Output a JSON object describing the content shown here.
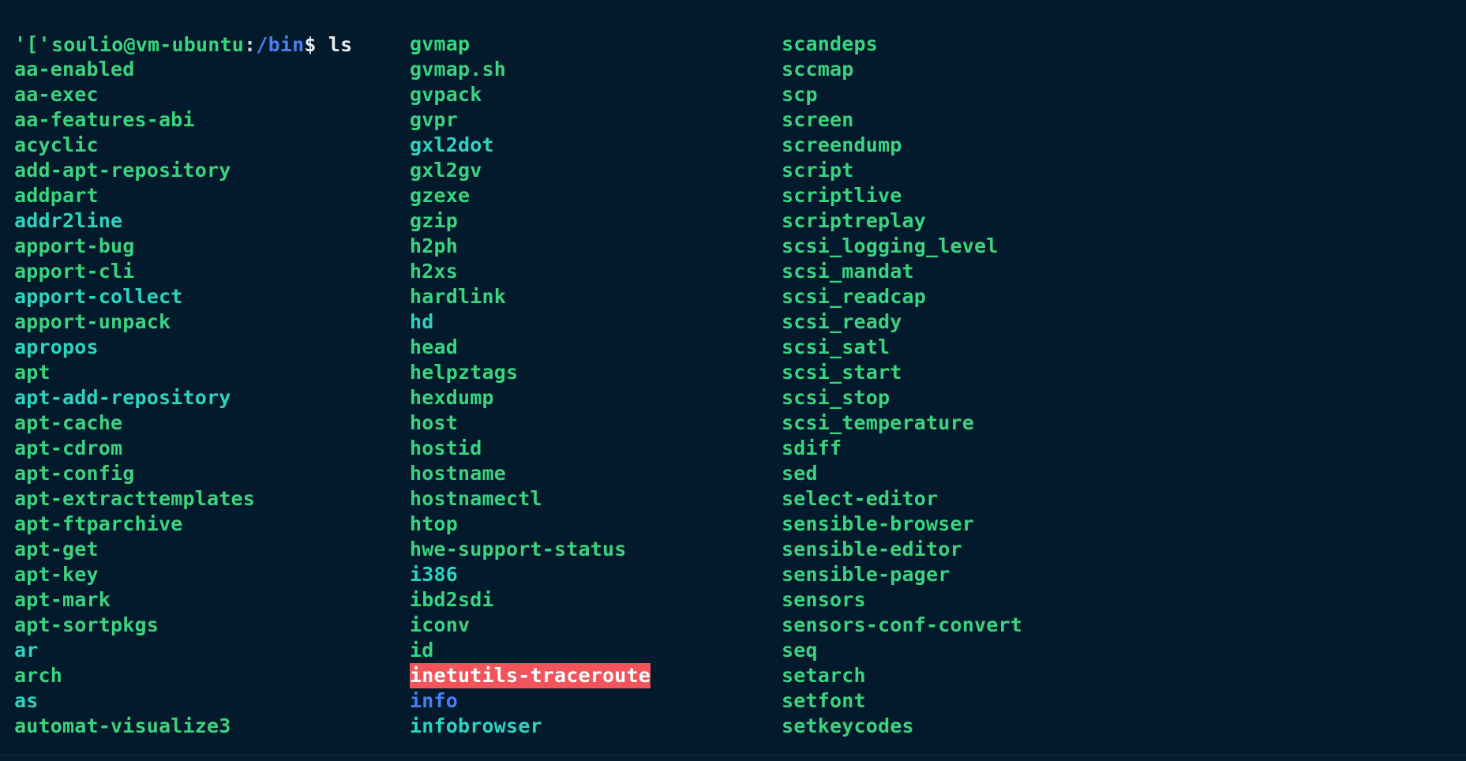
{
  "terminal": {
    "background_color": "#021a2b",
    "colors": {
      "executable_green": "#3bd37f",
      "symlink_cyan": "#2dd4bf",
      "directory_blue": "#4a7ef0",
      "orphan_link_bg": "#f2545b",
      "orphan_link_fg": "#ffffff",
      "prompt_text": "#e8eef3"
    }
  },
  "prompt": {
    "user_host": "soulio@vm-ubuntu",
    "colon": ":",
    "path": "/bin",
    "dollar": "$ ",
    "command": "ls"
  },
  "listing": {
    "columns": 3,
    "rows": 28,
    "entries": [
      [
        {
          "name": "'['",
          "type": "exe"
        },
        {
          "name": "gvmap",
          "type": "exe"
        },
        {
          "name": "scandeps",
          "type": "exe"
        }
      ],
      [
        {
          "name": "aa-enabled",
          "type": "exe"
        },
        {
          "name": "gvmap.sh",
          "type": "exe"
        },
        {
          "name": "sccmap",
          "type": "exe"
        }
      ],
      [
        {
          "name": "aa-exec",
          "type": "exe"
        },
        {
          "name": "gvpack",
          "type": "exe"
        },
        {
          "name": "scp",
          "type": "exe"
        }
      ],
      [
        {
          "name": "aa-features-abi",
          "type": "exe"
        },
        {
          "name": "gvpr",
          "type": "exe"
        },
        {
          "name": "screen",
          "type": "exe"
        }
      ],
      [
        {
          "name": "acyclic",
          "type": "exe"
        },
        {
          "name": "gxl2dot",
          "type": "link"
        },
        {
          "name": "screendump",
          "type": "exe"
        }
      ],
      [
        {
          "name": "add-apt-repository",
          "type": "exe"
        },
        {
          "name": "gxl2gv",
          "type": "exe"
        },
        {
          "name": "script",
          "type": "exe"
        }
      ],
      [
        {
          "name": "addpart",
          "type": "exe"
        },
        {
          "name": "gzexe",
          "type": "exe"
        },
        {
          "name": "scriptlive",
          "type": "exe"
        }
      ],
      [
        {
          "name": "addr2line",
          "type": "link"
        },
        {
          "name": "gzip",
          "type": "exe"
        },
        {
          "name": "scriptreplay",
          "type": "exe"
        }
      ],
      [
        {
          "name": "apport-bug",
          "type": "exe"
        },
        {
          "name": "h2ph",
          "type": "exe"
        },
        {
          "name": "scsi_logging_level",
          "type": "exe"
        }
      ],
      [
        {
          "name": "apport-cli",
          "type": "exe"
        },
        {
          "name": "h2xs",
          "type": "exe"
        },
        {
          "name": "scsi_mandat",
          "type": "exe"
        }
      ],
      [
        {
          "name": "apport-collect",
          "type": "link"
        },
        {
          "name": "hardlink",
          "type": "exe"
        },
        {
          "name": "scsi_readcap",
          "type": "exe"
        }
      ],
      [
        {
          "name": "apport-unpack",
          "type": "exe"
        },
        {
          "name": "hd",
          "type": "link"
        },
        {
          "name": "scsi_ready",
          "type": "exe"
        }
      ],
      [
        {
          "name": "apropos",
          "type": "link"
        },
        {
          "name": "head",
          "type": "exe"
        },
        {
          "name": "scsi_satl",
          "type": "exe"
        }
      ],
      [
        {
          "name": "apt",
          "type": "exe"
        },
        {
          "name": "helpztags",
          "type": "exe"
        },
        {
          "name": "scsi_start",
          "type": "exe"
        }
      ],
      [
        {
          "name": "apt-add-repository",
          "type": "link"
        },
        {
          "name": "hexdump",
          "type": "exe"
        },
        {
          "name": "scsi_stop",
          "type": "exe"
        }
      ],
      [
        {
          "name": "apt-cache",
          "type": "exe"
        },
        {
          "name": "host",
          "type": "exe"
        },
        {
          "name": "scsi_temperature",
          "type": "exe"
        }
      ],
      [
        {
          "name": "apt-cdrom",
          "type": "exe"
        },
        {
          "name": "hostid",
          "type": "exe"
        },
        {
          "name": "sdiff",
          "type": "exe"
        }
      ],
      [
        {
          "name": "apt-config",
          "type": "exe"
        },
        {
          "name": "hostname",
          "type": "exe"
        },
        {
          "name": "sed",
          "type": "exe"
        }
      ],
      [
        {
          "name": "apt-extracttemplates",
          "type": "exe"
        },
        {
          "name": "hostnamectl",
          "type": "exe"
        },
        {
          "name": "select-editor",
          "type": "exe"
        }
      ],
      [
        {
          "name": "apt-ftparchive",
          "type": "exe"
        },
        {
          "name": "htop",
          "type": "exe"
        },
        {
          "name": "sensible-browser",
          "type": "exe"
        }
      ],
      [
        {
          "name": "apt-get",
          "type": "exe"
        },
        {
          "name": "hwe-support-status",
          "type": "exe"
        },
        {
          "name": "sensible-editor",
          "type": "exe"
        }
      ],
      [
        {
          "name": "apt-key",
          "type": "exe"
        },
        {
          "name": "i386",
          "type": "link"
        },
        {
          "name": "sensible-pager",
          "type": "exe"
        }
      ],
      [
        {
          "name": "apt-mark",
          "type": "exe"
        },
        {
          "name": "ibd2sdi",
          "type": "exe"
        },
        {
          "name": "sensors",
          "type": "exe"
        }
      ],
      [
        {
          "name": "apt-sortpkgs",
          "type": "exe"
        },
        {
          "name": "iconv",
          "type": "exe"
        },
        {
          "name": "sensors-conf-convert",
          "type": "exe"
        }
      ],
      [
        {
          "name": "ar",
          "type": "link"
        },
        {
          "name": "id",
          "type": "exe"
        },
        {
          "name": "seq",
          "type": "exe"
        }
      ],
      [
        {
          "name": "arch",
          "type": "exe"
        },
        {
          "name": "inetutils-traceroute",
          "type": "orphan"
        },
        {
          "name": "setarch",
          "type": "exe"
        }
      ],
      [
        {
          "name": "as",
          "type": "link"
        },
        {
          "name": "info",
          "type": "dir"
        },
        {
          "name": "setfont",
          "type": "exe"
        }
      ],
      [
        {
          "name": "automat-visualize3",
          "type": "exe"
        },
        {
          "name": "infobrowser",
          "type": "link"
        },
        {
          "name": "setkeycodes",
          "type": "exe"
        }
      ]
    ]
  }
}
